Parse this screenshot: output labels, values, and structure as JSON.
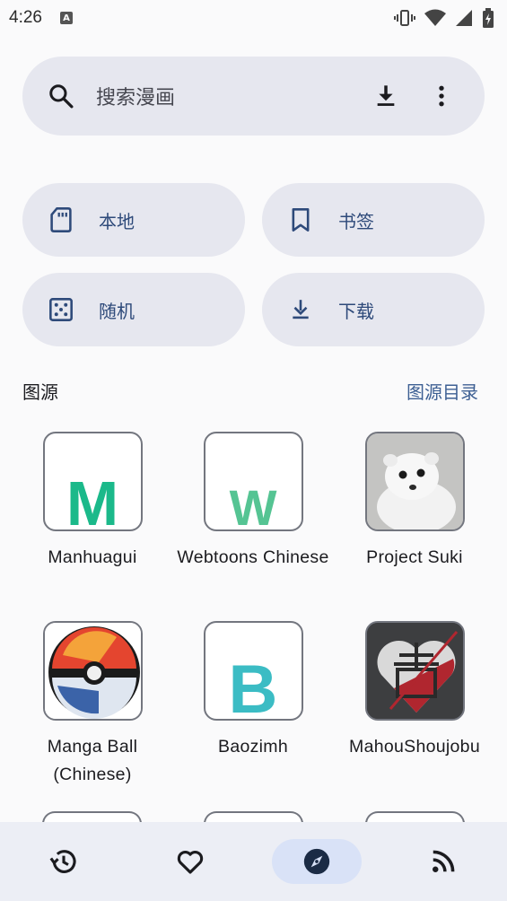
{
  "status_bar": {
    "time": "4:26",
    "notification_icon": "A"
  },
  "search": {
    "placeholder": "搜索漫画"
  },
  "quick_actions": {
    "local": "本地",
    "bookmarks": "书签",
    "random": "随机",
    "downloads": "下载"
  },
  "sources_section": {
    "title": "图源",
    "catalog_link": "图源目录",
    "items": [
      {
        "name": "Manhuagui",
        "letter": "M",
        "color": "#1bb98a"
      },
      {
        "name": "Webtoons Chinese",
        "letter": "W",
        "color": "#55c493"
      },
      {
        "name": "Project Suki"
      },
      {
        "name": "Manga Ball (Chinese)"
      },
      {
        "name": "Baozimh",
        "letter": "B",
        "color": "#3bbcc4"
      },
      {
        "name": "MahouShoujobu"
      }
    ]
  },
  "bottom_nav": {
    "items": [
      "history-icon",
      "favorite-icon",
      "explore-icon",
      "feed-icon"
    ],
    "active": "explore-icon"
  },
  "colors": {
    "accent": "#3d5f93",
    "surface": "#e6e7ef",
    "nav_active": "#d9e2f7"
  }
}
